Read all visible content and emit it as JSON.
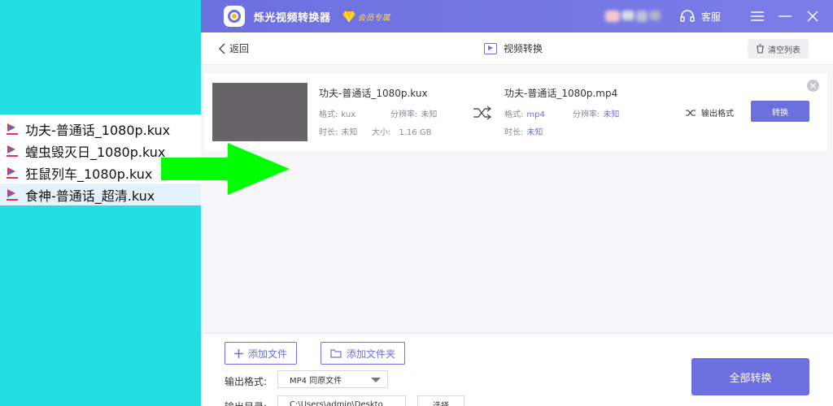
{
  "explorer": {
    "files": [
      {
        "name": "功夫-普通话_1080p.kux",
        "selected": false
      },
      {
        "name": "蝗虫毁灭日_1080p.kux",
        "selected": false
      },
      {
        "name": "狂鼠列车_1080p.kux",
        "selected": false
      },
      {
        "name": "食神-普通话_超清.kux",
        "selected": true
      }
    ]
  },
  "titlebar": {
    "app_title": "烁光视频转换器",
    "vip_label": "会员专属",
    "service_label": "客服"
  },
  "subbar": {
    "back_label": "返回",
    "page_title": "视频转换",
    "clear_label": "清空列表"
  },
  "task": {
    "source_name": "功夫-普通话_1080p.kux",
    "format_label": "格式:",
    "source_format": "kux",
    "resolution_label": "分辨率:",
    "source_resolution": "未知",
    "duration_label": "时长:",
    "source_duration": "未知",
    "size_label": "大小:",
    "source_size": "1.16 GB",
    "target_name": "功夫-普通话_1080p.mp4",
    "target_format": "mp4",
    "target_resolution": "未知",
    "target_duration": "未知",
    "output_format_label": "输出格式",
    "convert_label": "转换"
  },
  "bottom": {
    "add_file_label": "添加文件",
    "add_folder_label": "添加文件夹",
    "output_format_label": "输出格式:",
    "output_format_value": "MP4 同原文件",
    "output_dir_label": "输出目录:",
    "output_dir_value": "C:\\Users\\admin\\Deskto",
    "choose_label": "选择",
    "convert_all_label": "全部转换"
  },
  "colors": {
    "accent": "#6c6fe0",
    "background_cyan": "#22dfe3",
    "arrow_green": "#00ff00"
  }
}
